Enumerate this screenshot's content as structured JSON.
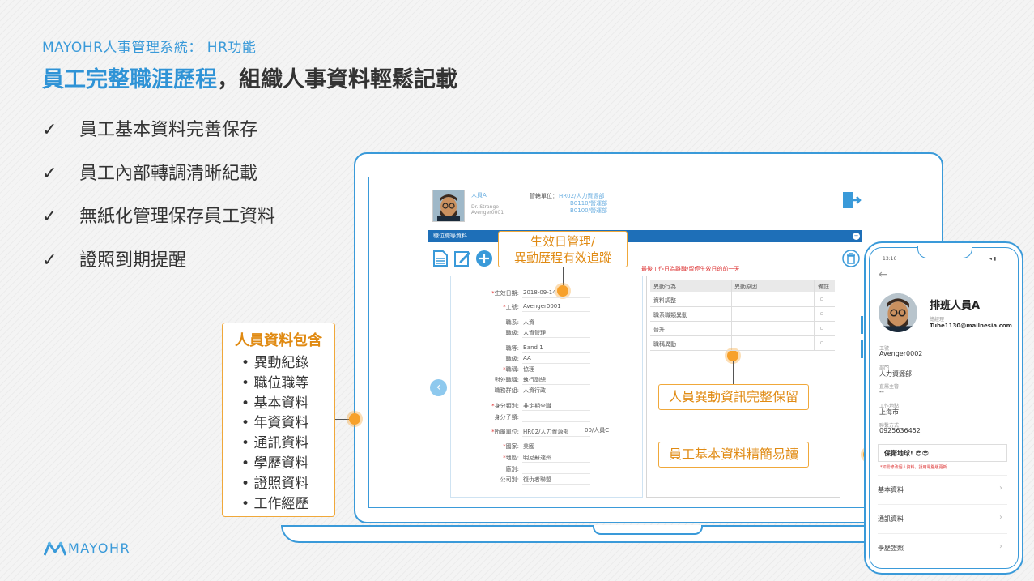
{
  "header": {
    "subtitle": "MAYOHR人事管理系統： HR功能",
    "headline_highlight": "員工完整職涯歷程",
    "headline_rest": "，組織人事資料輕鬆記載"
  },
  "features": [
    {
      "check": "✓",
      "text": "員工基本資料完善保存"
    },
    {
      "check": "✓",
      "text": "員工內部轉調清晰紀載"
    },
    {
      "check": "✓",
      "text": "無紙化管理保存員工資料"
    },
    {
      "check": "✓",
      "text": "證照到期提醒"
    }
  ],
  "side_box": {
    "title": "人員資料包含",
    "items": [
      "異動紀錄",
      "職位職等",
      "基本資料",
      "年資資料",
      "通訊資料",
      "學歷資料",
      "證照資料",
      "工作經歷"
    ],
    "bullet": "•"
  },
  "callouts": {
    "effective_date": [
      "生效日管理/",
      "異動歷程有效追蹤"
    ],
    "change_info": "人員異動資訊完整保留",
    "basic_info": "員工基本資料精簡易讀"
  },
  "app": {
    "employee_name": "人員A",
    "employee_nick": "Dr. Strange",
    "employee_id_line": "Avenger0001",
    "dept_label": "管轄單位：",
    "dept_lines": [
      "HR02/人力資源部",
      "B0110/營運部",
      "B0100/營運部"
    ],
    "panel_title": "職位職等資料",
    "collapse_symbol": "−",
    "warning": "最後工作日為離職/留停生效日的前一天",
    "prev_symbol": "‹",
    "form_rows": [
      {
        "label": "生效日期:",
        "value": "2018-09-14",
        "required": true
      },
      {
        "label": "工號:",
        "value": "Avenger0001",
        "required": true
      },
      {
        "label": "職系:",
        "value": "人資",
        "required": false
      },
      {
        "label": "職級:",
        "value": "人資管理",
        "required": false
      },
      {
        "label": "職等:",
        "value": "Band 1",
        "required": false
      },
      {
        "label": "職級:",
        "value": "AA",
        "required": false
      },
      {
        "label": "職稱:",
        "value": "協理",
        "required": true
      },
      {
        "label": "對外職稱:",
        "value": "執行副總",
        "required": false
      },
      {
        "label": "職務群組:",
        "value": "人資行政",
        "required": false
      },
      {
        "label": "身分類別:",
        "value": "非定期全職",
        "required": true
      },
      {
        "label": "身分子類:",
        "value": "",
        "required": false
      },
      {
        "label": "所屬單位:",
        "value": "HR02/人力資源部",
        "required": true,
        "extra": "00/人員C"
      },
      {
        "label": "國家:",
        "value": "美國",
        "required": true
      },
      {
        "label": "地區:",
        "value": "明尼蘇達州",
        "required": true
      },
      {
        "label": "廠別:",
        "value": "",
        "required": false
      },
      {
        "label": "公司別:",
        "value": "復仇者聯盟",
        "required": false
      }
    ],
    "history_headers": [
      "異動行為",
      "異動原因",
      "備註"
    ],
    "history_rows": [
      "資料調整",
      "職系職類異動",
      "晉升",
      "職稱異動"
    ]
  },
  "phone": {
    "time": "13:16",
    "status": "◂ ▮",
    "back": "←",
    "name": "排班人員A",
    "role": "總經理",
    "email": "Tube1130@mailnesia.com",
    "fields": [
      {
        "label": "工號",
        "value": "Avenger0002"
      },
      {
        "label": "部門",
        "value": "人力資源部"
      },
      {
        "label": "直屬主管",
        "value": "--"
      },
      {
        "label": "工作地點",
        "value": "上海市"
      },
      {
        "label": "聯繫方式",
        "value": "0925636452"
      }
    ],
    "motto": "保衛地球! 😎😎",
    "note": "*如需修改個人資料，請用電腦版更新",
    "menu": [
      "基本資料",
      "通訊資料",
      "學歷證照"
    ],
    "chevron": "›"
  },
  "logo": "MAYOHR"
}
